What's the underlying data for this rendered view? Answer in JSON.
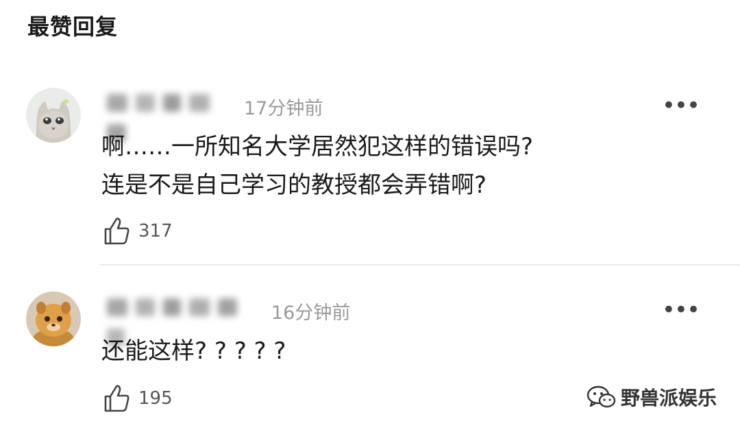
{
  "header": {
    "title": "最赞回复"
  },
  "comments": [
    {
      "time": "17分钟前",
      "text": "啊……一所知名大学居然犯这样的错误吗?\n连是不是自己学习的教授都会弄错啊?",
      "likes": "317",
      "more_label": "•••"
    },
    {
      "time": "16分钟前",
      "text": "还能这样? ? ? ? ?",
      "likes": "195",
      "more_label": "•••"
    }
  ],
  "watermark": {
    "text": "野兽派娱乐"
  }
}
